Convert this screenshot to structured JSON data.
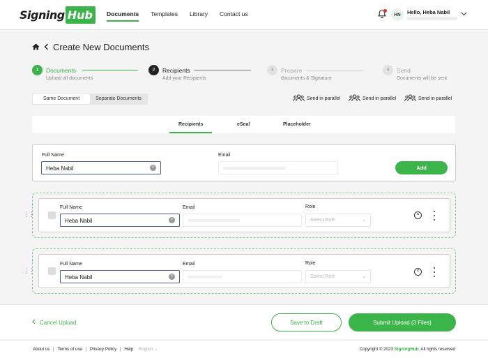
{
  "brand": {
    "logo_part1": "Signing",
    "logo_part2": "Hub",
    "accent": "#3bb54a"
  },
  "nav": {
    "items": [
      "Documents",
      "Templates",
      "Library",
      "Contact us"
    ],
    "active": "Documents"
  },
  "header": {
    "notifications_icon": "bell-icon",
    "avatar_initials": "HN",
    "user_greeting": "Hello, Heba Nabil"
  },
  "page": {
    "title": "Create New Documents"
  },
  "steps": [
    {
      "num": "1",
      "title": "Documents",
      "subtitle": "Upload all documents",
      "state": "done"
    },
    {
      "num": "2",
      "title": "Recipients",
      "subtitle": "Add your Recipients",
      "state": "current"
    },
    {
      "num": "3",
      "title": "Prepare",
      "subtitle": "documents & Signature",
      "state": "todo"
    },
    {
      "num": "4",
      "title": "Send",
      "subtitle": "Documents will be sent",
      "state": "todo"
    }
  ],
  "doc_mode": {
    "options": [
      "Same Document",
      "Separate Documents"
    ],
    "selected": "Same Document"
  },
  "parallel_label": "Send in parallel",
  "tabs": {
    "items": [
      "Recipients",
      "eSeal",
      "Placeholder"
    ],
    "active": "Recipients"
  },
  "add_form": {
    "full_name_label": "Full Name",
    "full_name_value": "Heba Nabil",
    "email_label": "Email",
    "add_label": "Add"
  },
  "recipients": [
    {
      "full_name_label": "Full Name",
      "full_name": "Heba Nabil",
      "email_label": "Email",
      "role_label": "Role",
      "role_placeholder": "Select Role"
    },
    {
      "full_name_label": "Full Name",
      "full_name": "Heba Nabil",
      "email_label": "Email",
      "role_label": "Role",
      "role_placeholder": "Select Role"
    }
  ],
  "actions": {
    "cancel": "Cancel Upload",
    "draft": "Save to Draft",
    "submit": "Submit Upload (3 Files)"
  },
  "legal": {
    "links": [
      "About us",
      "Terms of use",
      "Privacy Policy",
      "Help"
    ],
    "language": "English",
    "copyright_prefix": "Copyright © 2023 ",
    "copyright_brand": "SigningHub.",
    "copyright_suffix": " All rights reserved"
  }
}
